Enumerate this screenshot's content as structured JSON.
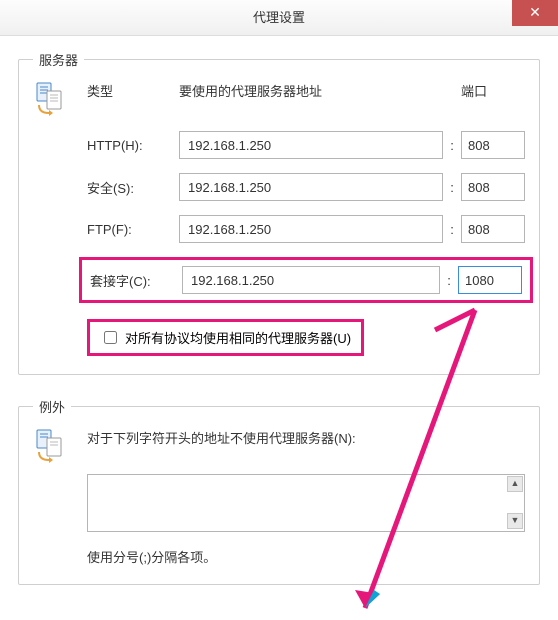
{
  "title": "代理设置",
  "server_group": {
    "legend": "服务器",
    "header_type": "类型",
    "header_addr": "要使用的代理服务器地址",
    "header_port": "端口",
    "rows": {
      "http": {
        "label": "HTTP(H):",
        "addr": "192.168.1.250",
        "port": "808"
      },
      "secure": {
        "label": "安全(S):",
        "addr": "192.168.1.250",
        "port": "808"
      },
      "ftp": {
        "label": "FTP(F):",
        "addr": "192.168.1.250",
        "port": "808"
      },
      "socks": {
        "label": "套接字(C):",
        "addr": "192.168.1.250",
        "port": "1080"
      }
    },
    "same_proxy_label": "对所有协议均使用相同的代理服务器(U)"
  },
  "exceptions_group": {
    "legend": "例外",
    "intro": "对于下列字符开头的地址不使用代理服务器(N):",
    "value": "",
    "hint": "使用分号(;)分隔各项。"
  },
  "annotation": {
    "color": "#e6177a"
  }
}
